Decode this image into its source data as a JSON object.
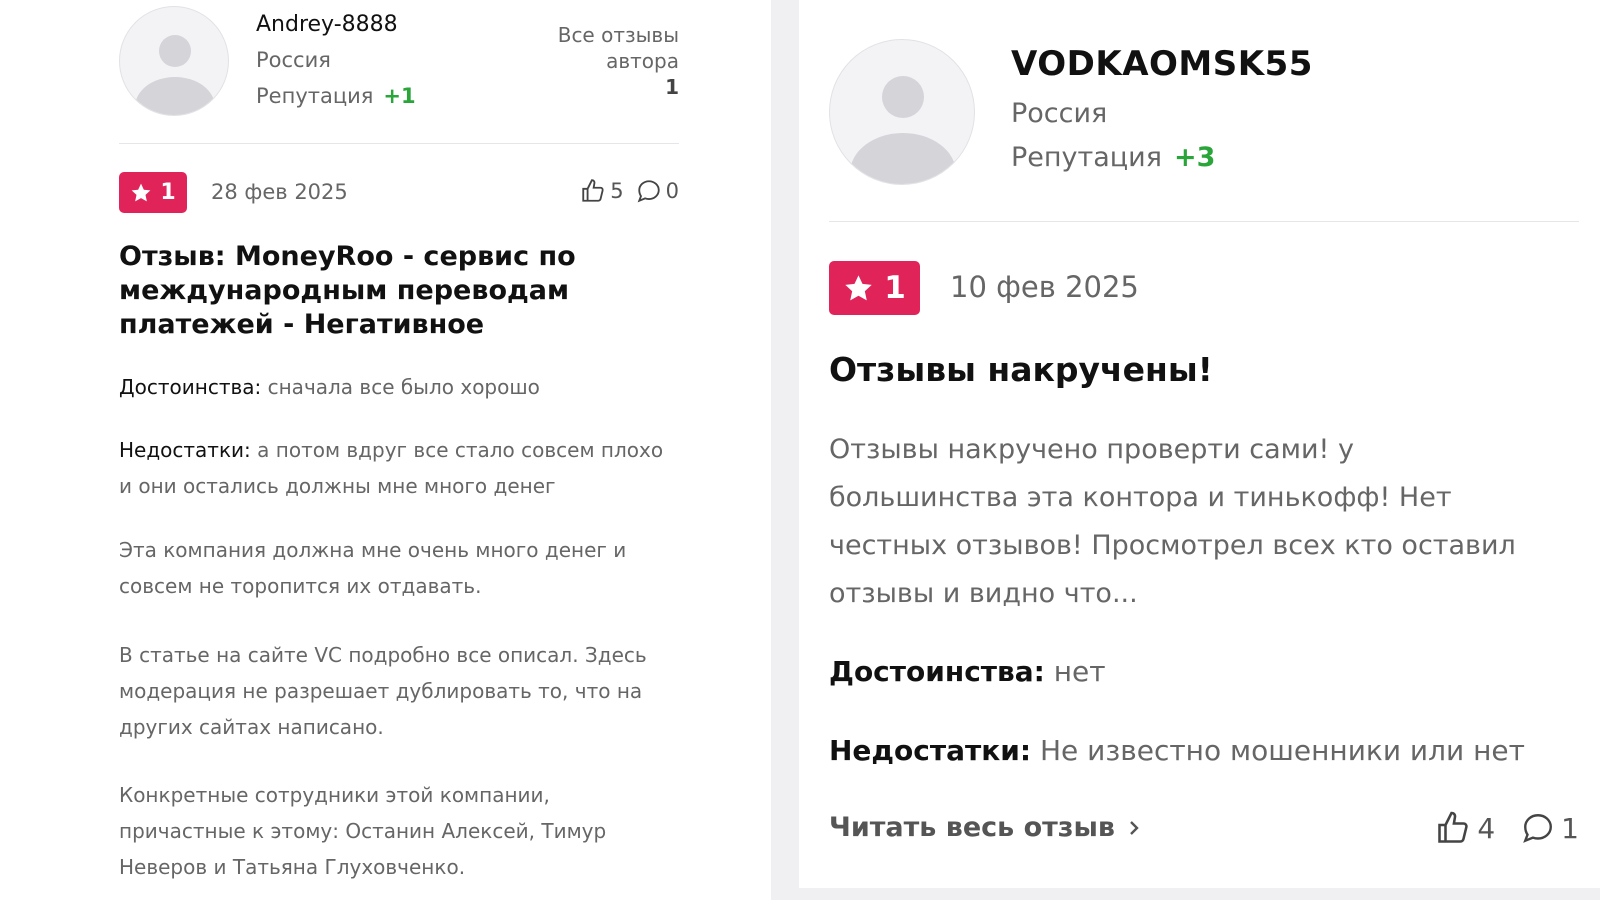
{
  "left_review": {
    "author": {
      "name": "Andrey-8888",
      "country": "Россия",
      "reputation_label": "Репутация",
      "reputation_value": "+1"
    },
    "all_reviews": {
      "label_line1": "Все отзывы",
      "label_line2": "автора",
      "count": "1"
    },
    "rating": "1",
    "date": "28 фев 2025",
    "likes": "5",
    "comments": "0",
    "title": "Отзыв: MoneyRoo - сервис по международным переводам платежей - Негативное",
    "pros_label": "Достоинства:",
    "pros_text": "сначала все было хорошо",
    "cons_label": "Недостатки:",
    "cons_text": "а потом вдруг все стало совсем плохо и они остались должны мне много денег",
    "paragraphs": [
      "Эта компания должна мне очень много денег и совсем не торопится их отдавать.",
      "В статье на сайте VC подробно все описал. Здесь модерация не разрешает дублировать то, что на других сайтах написано.",
      "Конкретные сотрудники этой компании, причастные к этому: Останин Алексей, Тимур Неверов и Татьяна Глуховченко."
    ]
  },
  "right_review": {
    "author": {
      "name": "VODKAOMSK55",
      "country": "Россия",
      "reputation_label": "Репутация",
      "reputation_value": "+3"
    },
    "rating": "1",
    "date": "10 фев 2025",
    "title": "Отзывы накручены!",
    "body": "Отзывы накручено проверти сами! у большинства эта контора и тинькофф! Нет честных отзывов! Просмотрел всех кто оставил отзывы и видно что...",
    "pros_label": "Достоинства:",
    "pros_text": "нет",
    "cons_label": "Недостатки:",
    "cons_text": "Не известно мошенники или нет",
    "read_more": "Читать весь отзыв",
    "likes": "4",
    "comments": "1"
  },
  "colors": {
    "badge": "#e0245a",
    "reputation": "#2aa53a",
    "muted_text": "#666666"
  },
  "icons": [
    "user-avatar-placeholder",
    "star-icon",
    "thumbs-up-icon",
    "comment-icon",
    "chevron-right-icon"
  ]
}
